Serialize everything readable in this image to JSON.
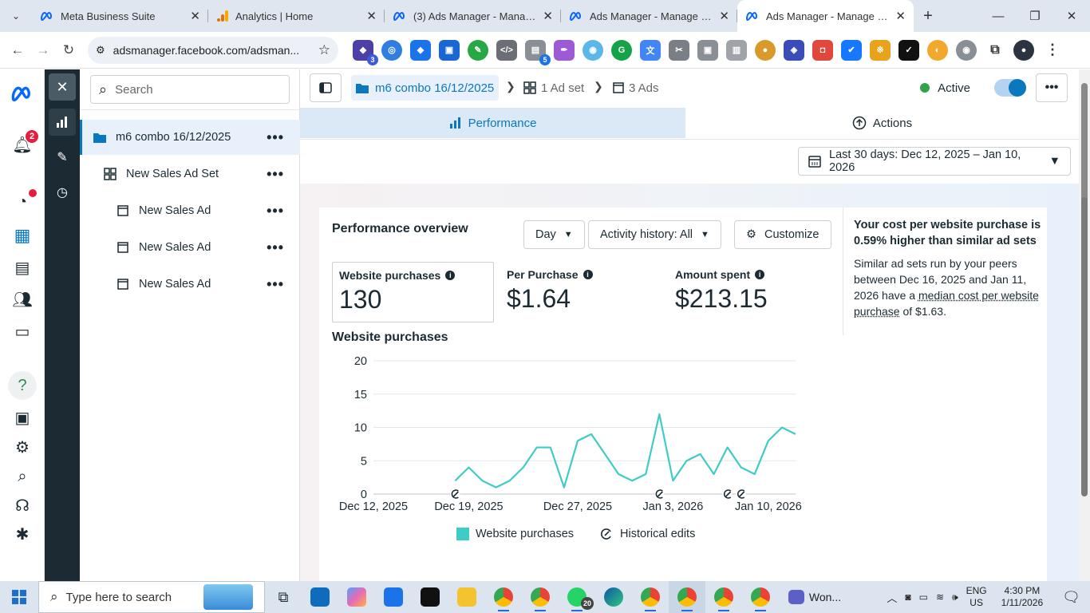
{
  "browser": {
    "tabs": [
      {
        "label": "Meta Business Suite",
        "icon": "meta-icon"
      },
      {
        "label": "Analytics | Home",
        "icon": "analytics-icon"
      },
      {
        "label": "(3) Ads Manager - Manage ads",
        "icon": "meta-icon"
      },
      {
        "label": "Ads Manager - Manage ads",
        "icon": "meta-icon"
      },
      {
        "label": "Ads Manager - Manage ads",
        "icon": "meta-icon",
        "active": true
      }
    ],
    "url": "adsmanager.facebook.com/adsman...",
    "ext_badges": {
      "ext1": "3",
      "ext2": "5"
    }
  },
  "rail": {
    "notifications_count": "2"
  },
  "tree": {
    "search_placeholder": "Search",
    "items": [
      {
        "label": "m6 combo 16/12/2025",
        "level": "campaign"
      },
      {
        "label": "New Sales Ad Set",
        "level": "adset"
      },
      {
        "label": "New Sales Ad",
        "level": "ad"
      },
      {
        "label": "New Sales Ad",
        "level": "ad"
      },
      {
        "label": "New Sales Ad",
        "level": "ad"
      }
    ]
  },
  "header": {
    "campaign": "m6 combo 16/12/2025",
    "adsets": "1 Ad set",
    "ads": "3 Ads",
    "status": "Active"
  },
  "subtabs": {
    "performance": "Performance",
    "actions": "Actions"
  },
  "date_range": "Last 30 days: Dec 12, 2025 – Jan 10, 2026",
  "overview": {
    "title": "Performance overview",
    "granularity": "Day",
    "activity_history": "Activity history: All",
    "customize": "Customize",
    "metrics": [
      {
        "label": "Website purchases",
        "value": "130"
      },
      {
        "label": "Per Purchase",
        "value": "$1.64"
      },
      {
        "label": "Amount spent",
        "value": "$213.15"
      }
    ],
    "chart_heading": "Website purchases"
  },
  "insight": {
    "heading": "Your cost per website purchase is 0.59% higher than similar ad sets",
    "body_1": "Similar ad sets run by your peers between Dec 16, 2025 and Jan 11, 2026 have a ",
    "link": "median cost per website purchase",
    "body_2": " of $1.63."
  },
  "chart_data": {
    "type": "line",
    "title": "Website purchases",
    "x_tick_labels": [
      "Dec 12, 2025",
      "Dec 19, 2025",
      "Dec 27, 2025",
      "Jan 3, 2026",
      "Jan 10, 2026"
    ],
    "y_ticks": [
      0,
      5,
      10,
      15,
      20
    ],
    "ylim": [
      0,
      20
    ],
    "series": [
      {
        "name": "Website purchases",
        "color": "#3ecdc5",
        "x": [
          "Dec 18, 2025",
          "Dec 19, 2025",
          "Dec 20, 2025",
          "Dec 21, 2025",
          "Dec 22, 2025",
          "Dec 23, 2025",
          "Dec 24, 2025",
          "Dec 25, 2025",
          "Dec 26, 2025",
          "Dec 27, 2025",
          "Dec 28, 2025",
          "Dec 29, 2025",
          "Dec 30, 2025",
          "Dec 31, 2025",
          "Jan 1, 2026",
          "Jan 2, 2026",
          "Jan 3, 2026",
          "Jan 4, 2026",
          "Jan 5, 2026",
          "Jan 6, 2026",
          "Jan 7, 2026",
          "Jan 8, 2026",
          "Jan 9, 2026",
          "Jan 10, 2026"
        ],
        "values": [
          2,
          4,
          2,
          1,
          2,
          4,
          7,
          7,
          1,
          8,
          9,
          6,
          3,
          2,
          3,
          12,
          2,
          5,
          6,
          3,
          7,
          4,
          3,
          8
        ]
      }
    ],
    "extra_points": {
      "Jan 11, 2026": 10,
      "Jan 12, 2026": 9
    },
    "historical_edits": [
      "Dec 18, 2025",
      "Jan 2, 2026",
      "Jan 7, 2026",
      "Jan 8, 2026"
    ],
    "legend": [
      "Website purchases",
      "Historical edits"
    ],
    "grid": true
  },
  "taskbar": {
    "search_placeholder": "Type here to search",
    "whatsapp_badge": "20",
    "zoom_label": "Won...",
    "lang_1": "ENG",
    "lang_2": "US",
    "time": "4:30 PM",
    "date": "1/11/2026"
  }
}
